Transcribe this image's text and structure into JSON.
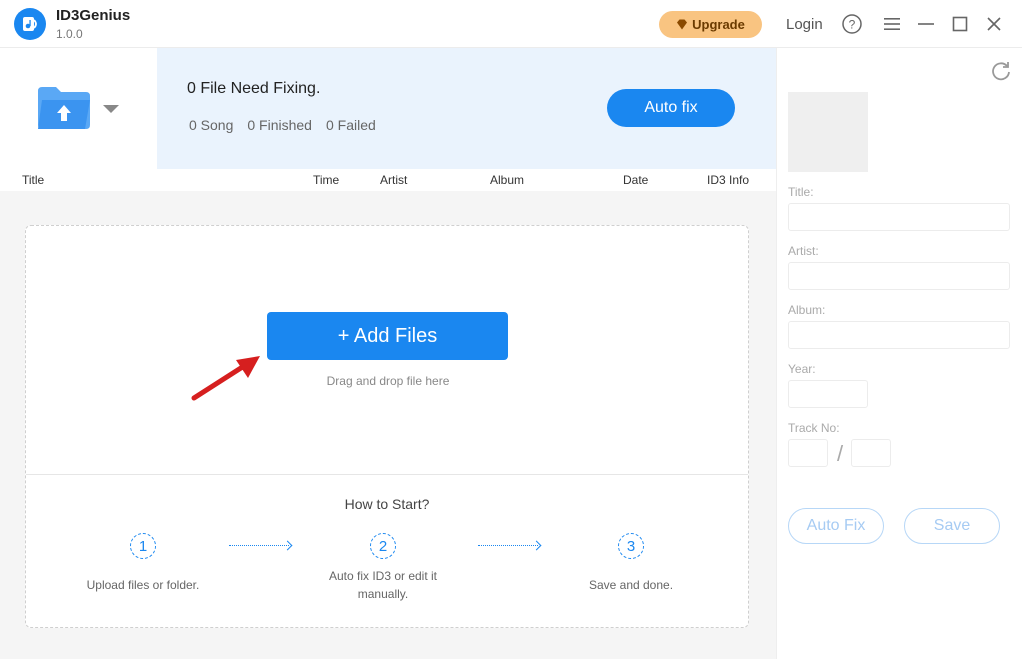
{
  "app": {
    "name": "ID3Genius",
    "version": "1.0.0"
  },
  "titlebar": {
    "upgrade_label": "Upgrade",
    "login_label": "Login"
  },
  "status": {
    "title": "0 File Need Fixing.",
    "song": "0 Song",
    "finished": "0 Finished",
    "failed": "0 Failed",
    "autofix_label": "Auto fix"
  },
  "columns": [
    "Title",
    "Time",
    "Artist",
    "Album",
    "Date",
    "ID3 Info"
  ],
  "dropzone": {
    "add_label": "+ Add Files",
    "hint": "Drag and drop file here"
  },
  "howto": {
    "title": "How to Start?",
    "steps": [
      {
        "num": "1",
        "label": "Upload files or folder."
      },
      {
        "num": "2",
        "label": "Auto fix ID3 or edit it manually."
      },
      {
        "num": "3",
        "label": "Save and done."
      }
    ]
  },
  "editor": {
    "title_label": "Title:",
    "artist_label": "Artist:",
    "album_label": "Album:",
    "year_label": "Year:",
    "track_label": "Track No:",
    "slash": "/",
    "autofix_label": "Auto Fix",
    "save_label": "Save"
  },
  "colors": {
    "accent": "#1a87f0",
    "upgrade": "#f9c481",
    "status_bg": "#eaf3fd"
  }
}
